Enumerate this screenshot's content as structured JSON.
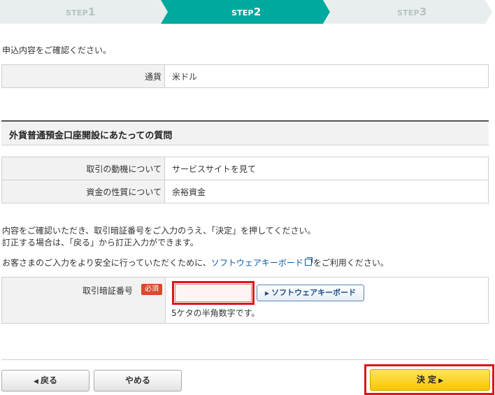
{
  "steps": [
    {
      "prefix": "STEP",
      "num": "1"
    },
    {
      "prefix": "STEP",
      "num": "2"
    },
    {
      "prefix": "STEP",
      "num": "3"
    }
  ],
  "intro": "申込内容をご確認ください。",
  "currency": {
    "label": "通貨",
    "value": "米ドル"
  },
  "section_title": "外貨普通預金口座開設にあたっての質問",
  "questions": [
    {
      "label": "取引の動機について",
      "value": "サービスサイトを見て"
    },
    {
      "label": "資金の性質について",
      "value": "余裕資金"
    }
  ],
  "instructions": {
    "line1": "内容をご確認いただき、取引暗証番号をご入力のうえ、「決定」を押してください。",
    "line2": "訂正する場合は、「戻る」から訂正入力ができます。",
    "line3_pre": "お客さまのご入力をより安全に行っていただくために、",
    "line3_link": "ソフトウェアキーボード",
    "line3_post": "をご利用ください。"
  },
  "pin": {
    "label": "取引暗証番号",
    "required_badge": "必須",
    "value": "",
    "keyboard_button": "ソフトウェアキーボード",
    "hint": "5ケタの半角数字です。"
  },
  "buttons": {
    "back": "戻る",
    "cancel": "やめる",
    "confirm": "決 定"
  },
  "colors": {
    "active_step": "#00a99d",
    "inactive_step": "#e8eeee",
    "highlight_frame": "#e0121b",
    "confirm_button": "#f7c600"
  }
}
